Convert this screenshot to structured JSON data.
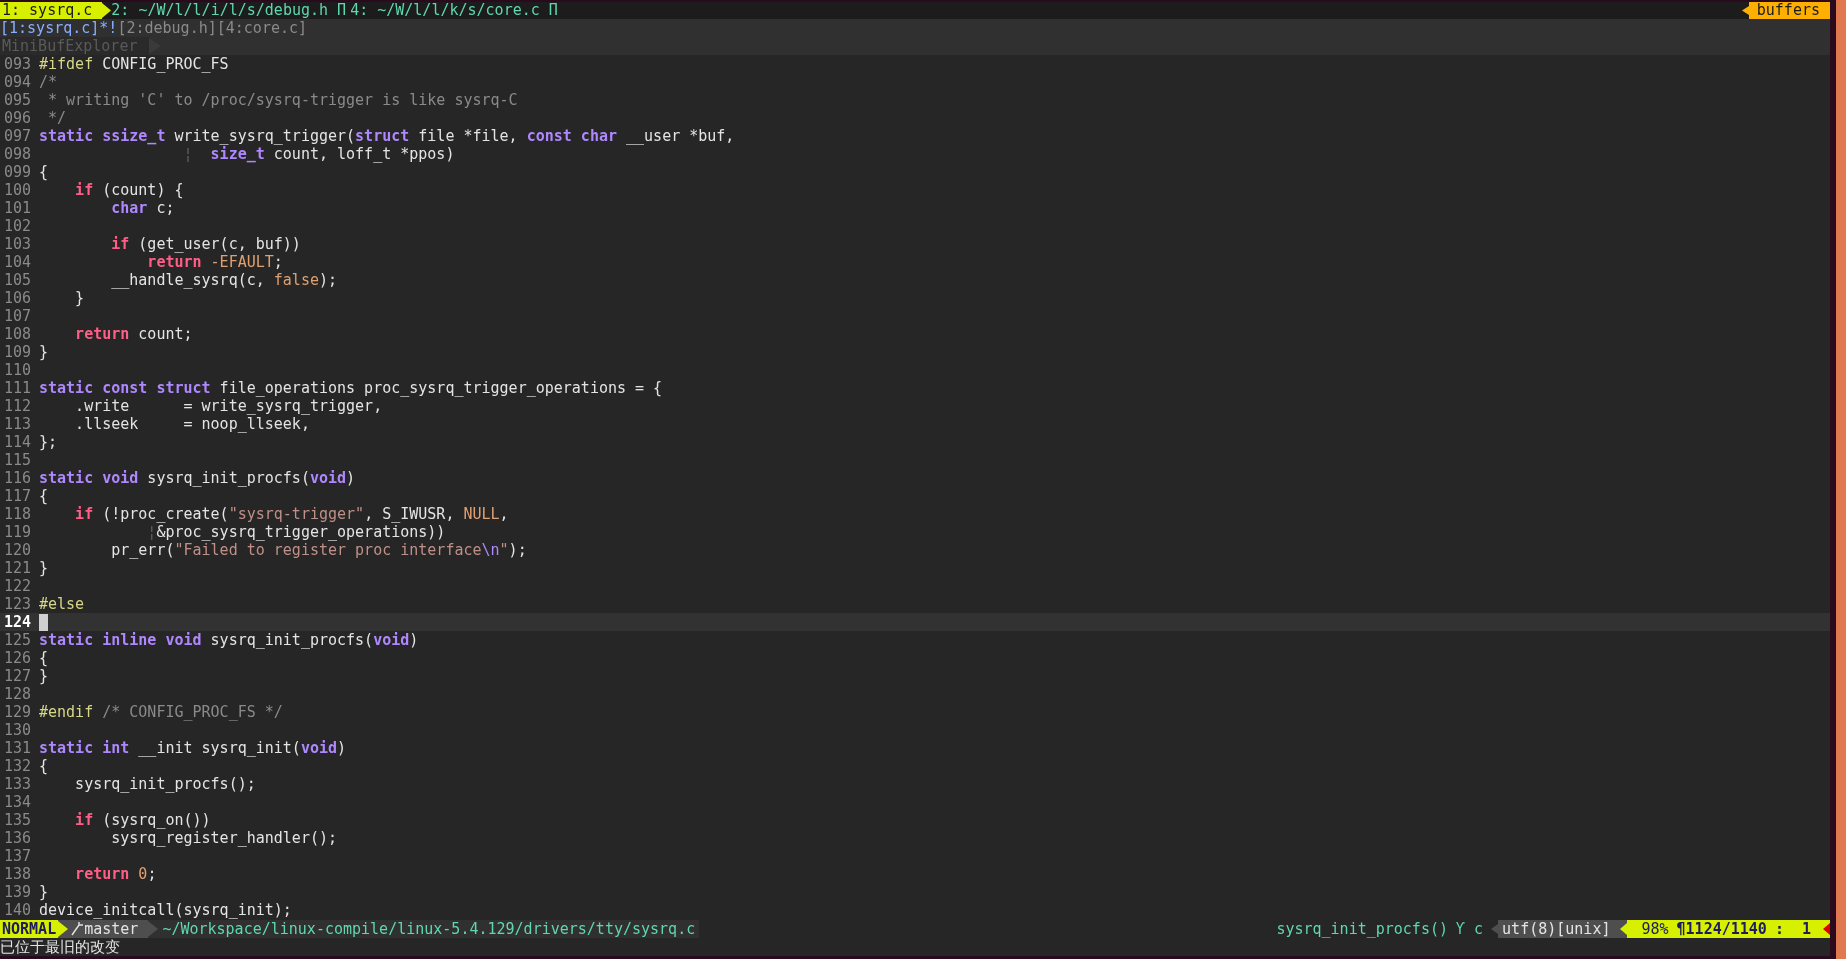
{
  "tabline": {
    "tabs": [
      {
        "label": "1: sysrq.c",
        "selected": true
      },
      {
        "label": "2: ~/W/l/l/i/l/s/debug.h Π",
        "selected": false
      },
      {
        "label": "4: ~/W/l/l/k/s/core.c Π",
        "selected": false
      }
    ],
    "buffers_label": "buffers"
  },
  "bufferline": [
    {
      "label": "[1:sysrq.c]*!",
      "selected": true
    },
    {
      "label": "[2:debug.h]",
      "selected": false
    },
    {
      "label": "[4:core.c]",
      "selected": false
    }
  ],
  "explorer_title": "MiniBufExplorer",
  "lines": [
    {
      "number": "093",
      "current": false,
      "tokens": [
        {
          "kind": "preproc",
          "text": "#ifdef"
        },
        {
          "kind": "plain",
          "text": " CONFIG_PROC_FS"
        }
      ]
    },
    {
      "number": "094",
      "current": false,
      "tokens": [
        {
          "kind": "comment",
          "text": "/*"
        }
      ]
    },
    {
      "number": "095",
      "current": false,
      "tokens": [
        {
          "kind": "comment",
          "text": " * writing 'C' to /proc/sysrq-trigger is like sysrq-C"
        }
      ]
    },
    {
      "number": "096",
      "current": false,
      "tokens": [
        {
          "kind": "comment",
          "text": " */"
        }
      ]
    },
    {
      "number": "097",
      "current": false,
      "tokens": [
        {
          "kind": "keyword",
          "text": "static"
        },
        {
          "kind": "keyword",
          "text": " ssize_t"
        },
        {
          "kind": "plain",
          "text": " write_sysrq_trigger("
        },
        {
          "kind": "keyword",
          "text": "struct"
        },
        {
          "kind": "plain",
          "text": " file *file, "
        },
        {
          "kind": "keyword",
          "text": "const"
        },
        {
          "kind": "keyword",
          "text": " char"
        },
        {
          "kind": "plain",
          "text": " __user *buf,"
        }
      ]
    },
    {
      "number": "098",
      "current": false,
      "tokens": [
        {
          "kind": "guide",
          "text": "                ¦"
        },
        {
          "kind": "keyword",
          "text": "  size_t"
        },
        {
          "kind": "plain",
          "text": " count, loff_t *ppos)"
        }
      ]
    },
    {
      "number": "099",
      "current": false,
      "tokens": [
        {
          "kind": "plain",
          "text": "{"
        }
      ]
    },
    {
      "number": "100",
      "current": false,
      "tokens": [
        {
          "kind": "control",
          "text": "    if"
        },
        {
          "kind": "plain",
          "text": " (count) {"
        }
      ]
    },
    {
      "number": "101",
      "current": false,
      "tokens": [
        {
          "kind": "keyword",
          "text": "        char"
        },
        {
          "kind": "plain",
          "text": " c;"
        }
      ]
    },
    {
      "number": "102",
      "current": false
    },
    {
      "number": "103",
      "current": false,
      "tokens": [
        {
          "kind": "control",
          "text": "        if"
        },
        {
          "kind": "plain",
          "text": " (get_user(c, buf))"
        }
      ]
    },
    {
      "number": "104",
      "current": false,
      "tokens": [
        {
          "kind": "control",
          "text": "            return"
        },
        {
          "kind": "constant",
          "text": " -EFAULT"
        },
        {
          "kind": "plain",
          "text": ";"
        }
      ]
    },
    {
      "number": "105",
      "current": false,
      "tokens": [
        {
          "kind": "plain",
          "text": "        __handle_sysrq(c, "
        },
        {
          "kind": "constant",
          "text": "false"
        },
        {
          "kind": "plain",
          "text": ");"
        }
      ]
    },
    {
      "number": "106",
      "current": false,
      "tokens": [
        {
          "kind": "plain",
          "text": "    }"
        }
      ]
    },
    {
      "number": "107",
      "current": false
    },
    {
      "number": "108",
      "current": false,
      "tokens": [
        {
          "kind": "control",
          "text": "    return"
        },
        {
          "kind": "plain",
          "text": " count;"
        }
      ]
    },
    {
      "number": "109",
      "current": false,
      "tokens": [
        {
          "kind": "plain",
          "text": "}"
        }
      ]
    },
    {
      "number": "110",
      "current": false
    },
    {
      "number": "111",
      "current": false,
      "tokens": [
        {
          "kind": "keyword",
          "text": "static"
        },
        {
          "kind": "keyword",
          "text": " const"
        },
        {
          "kind": "keyword",
          "text": " struct"
        },
        {
          "kind": "plain",
          "text": " file_operations proc_sysrq_trigger_operations = {"
        }
      ]
    },
    {
      "number": "112",
      "current": false,
      "tokens": [
        {
          "kind": "plain",
          "text": "    .write      = write_sysrq_trigger,"
        }
      ]
    },
    {
      "number": "113",
      "current": false,
      "tokens": [
        {
          "kind": "plain",
          "text": "    .llseek     = noop_llseek,"
        }
      ]
    },
    {
      "number": "114",
      "current": false,
      "tokens": [
        {
          "kind": "plain",
          "text": "};"
        }
      ]
    },
    {
      "number": "115",
      "current": false
    },
    {
      "number": "116",
      "current": false,
      "tokens": [
        {
          "kind": "keyword",
          "text": "static"
        },
        {
          "kind": "keyword",
          "text": " void"
        },
        {
          "kind": "plain",
          "text": " sysrq_init_procfs("
        },
        {
          "kind": "keyword",
          "text": "void"
        },
        {
          "kind": "plain",
          "text": ")"
        }
      ]
    },
    {
      "number": "117",
      "current": false,
      "tokens": [
        {
          "kind": "plain",
          "text": "{"
        }
      ]
    },
    {
      "number": "118",
      "current": false,
      "tokens": [
        {
          "kind": "control",
          "text": "    if"
        },
        {
          "kind": "plain",
          "text": " (!proc_create("
        },
        {
          "kind": "string",
          "text": "\"sysrq-trigger\""
        },
        {
          "kind": "plain",
          "text": ", S_IWUSR, "
        },
        {
          "kind": "constant",
          "text": "NULL"
        },
        {
          "kind": "plain",
          "text": ","
        }
      ]
    },
    {
      "number": "119",
      "current": false,
      "tokens": [
        {
          "kind": "guide",
          "text": "            ¦"
        },
        {
          "kind": "plain",
          "text": "&proc_sysrq_trigger_operations))"
        }
      ]
    },
    {
      "number": "120",
      "current": false,
      "tokens": [
        {
          "kind": "plain",
          "text": "        pr_err("
        },
        {
          "kind": "string",
          "text": "\"Failed to register proc interface"
        },
        {
          "kind": "escape",
          "text": "\\n"
        },
        {
          "kind": "string",
          "text": "\""
        },
        {
          "kind": "plain",
          "text": ");"
        }
      ]
    },
    {
      "number": "121",
      "current": false,
      "tokens": [
        {
          "kind": "plain",
          "text": "}"
        }
      ]
    },
    {
      "number": "122",
      "current": false
    },
    {
      "number": "123",
      "current": false,
      "tokens": [
        {
          "kind": "preproc",
          "text": "#else"
        }
      ]
    },
    {
      "number": "124",
      "current": true
    },
    {
      "number": "125",
      "current": false,
      "tokens": [
        {
          "kind": "keyword",
          "text": "static"
        },
        {
          "kind": "keyword",
          "text": " inline"
        },
        {
          "kind": "keyword",
          "text": " void"
        },
        {
          "kind": "plain",
          "text": " sysrq_init_procfs("
        },
        {
          "kind": "keyword",
          "text": "void"
        },
        {
          "kind": "plain",
          "text": ")"
        }
      ]
    },
    {
      "number": "126",
      "current": false,
      "tokens": [
        {
          "kind": "plain",
          "text": "{"
        }
      ]
    },
    {
      "number": "127",
      "current": false,
      "tokens": [
        {
          "kind": "plain",
          "text": "}"
        }
      ]
    },
    {
      "number": "128",
      "current": false
    },
    {
      "number": "129",
      "current": false,
      "tokens": [
        {
          "kind": "preproc",
          "text": "#endif"
        },
        {
          "kind": "comment",
          "text": " /* CONFIG_PROC_FS */"
        }
      ]
    },
    {
      "number": "130",
      "current": false
    },
    {
      "number": "131",
      "current": false,
      "tokens": [
        {
          "kind": "keyword",
          "text": "static"
        },
        {
          "kind": "keyword",
          "text": " int"
        },
        {
          "kind": "plain",
          "text": " __init sysrq_init("
        },
        {
          "kind": "keyword",
          "text": "void"
        },
        {
          "kind": "plain",
          "text": ")"
        }
      ]
    },
    {
      "number": "132",
      "current": false,
      "tokens": [
        {
          "kind": "plain",
          "text": "{"
        }
      ]
    },
    {
      "number": "133",
      "current": false,
      "tokens": [
        {
          "kind": "plain",
          "text": "    sysrq_init_procfs();"
        }
      ]
    },
    {
      "number": "134",
      "current": false
    },
    {
      "number": "135",
      "current": false,
      "tokens": [
        {
          "kind": "control",
          "text": "    if"
        },
        {
          "kind": "plain",
          "text": " (sysrq_on())"
        }
      ]
    },
    {
      "number": "136",
      "current": false,
      "tokens": [
        {
          "kind": "plain",
          "text": "        sysrq_register_handler();"
        }
      ]
    },
    {
      "number": "137",
      "current": false
    },
    {
      "number": "138",
      "current": false,
      "tokens": [
        {
          "kind": "control",
          "text": "    return"
        },
        {
          "kind": "number",
          "text": " 0"
        },
        {
          "kind": "plain",
          "text": ";"
        }
      ]
    },
    {
      "number": "139",
      "current": false,
      "tokens": [
        {
          "kind": "plain",
          "text": "}"
        }
      ]
    },
    {
      "number": "140",
      "current": false,
      "tokens": [
        {
          "kind": "plain",
          "text": "device_initcall(sysrq_init);"
        }
      ]
    }
  ],
  "status_bar": {
    "mode": "NORMAL",
    "branch": "master",
    "path": "~/Workspace/linux-compile/linux-5.4.129/drivers/tty/sysrq.c",
    "function": "sysrq_init_procfs()",
    "filetype": "Ƴ c",
    "encoding": "utf(8)[unix]",
    "percent": "98%",
    "position": "¶1124/1140",
    "column": ":  1"
  },
  "message": "已位于最旧的改变"
}
